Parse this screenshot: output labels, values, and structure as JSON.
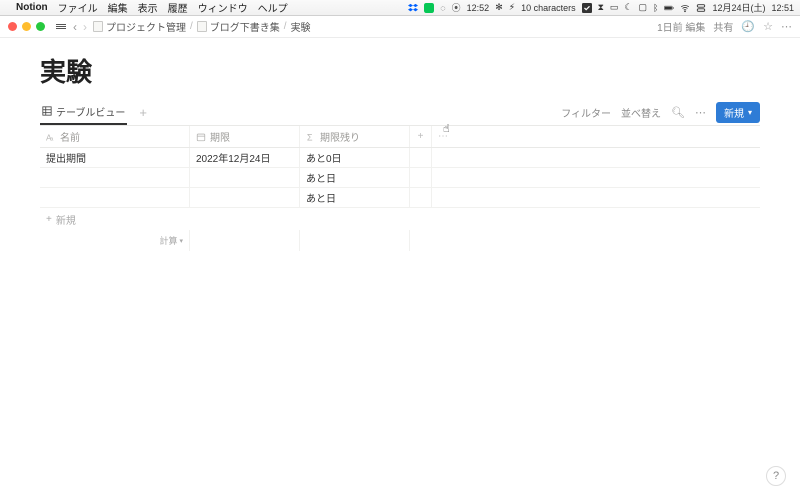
{
  "menubar": {
    "app": "Notion",
    "items": [
      "ファイル",
      "編集",
      "表示",
      "履歴",
      "ウィンドウ",
      "ヘルプ"
    ],
    "status_center_time": "12:52",
    "status_text": "10 characters",
    "date": "12月24日(土)",
    "clock": "12:51"
  },
  "toolbar": {
    "breadcrumb": [
      {
        "label": "プロジェクト管理"
      },
      {
        "label": "ブログ下書き集"
      },
      {
        "label": "実験"
      }
    ],
    "right": {
      "edited": "1日前 編集",
      "share": "共有"
    }
  },
  "page": {
    "title": "実験",
    "tabs": {
      "table_view": "テーブルビュー"
    },
    "controls": {
      "filter": "フィルター",
      "sort": "並べ替え",
      "new": "新規"
    }
  },
  "table": {
    "columns": {
      "name": {
        "label": "名前"
      },
      "deadline": {
        "label": "期限"
      },
      "remaining": {
        "label": "期限残り"
      }
    },
    "rows": [
      {
        "name": "提出期間",
        "deadline": "2022年12月24日",
        "remaining": "あと0日"
      },
      {
        "name": "",
        "deadline": "",
        "remaining": "あと日"
      },
      {
        "name": "",
        "deadline": "",
        "remaining": "あと日"
      }
    ],
    "add_row": "新規",
    "calc": "計算"
  },
  "help": "?"
}
